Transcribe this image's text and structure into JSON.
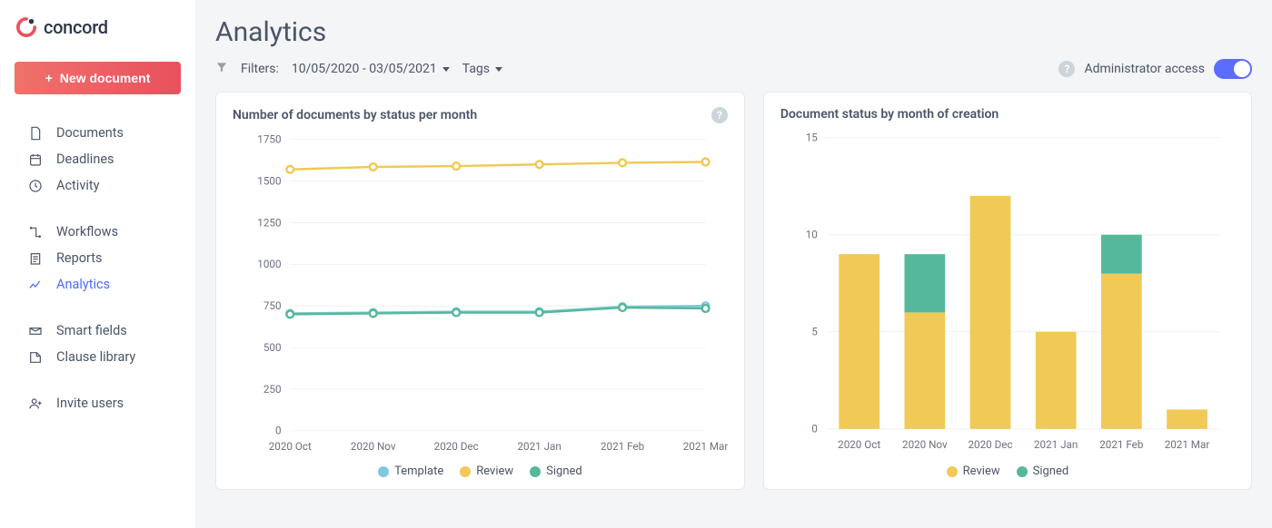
{
  "brand": {
    "name": "concord"
  },
  "sidebar": {
    "newDocument": "New document",
    "groups": [
      {
        "items": [
          {
            "label": "Documents",
            "icon": "document"
          },
          {
            "label": "Deadlines",
            "icon": "calendar"
          },
          {
            "label": "Activity",
            "icon": "clock"
          }
        ]
      },
      {
        "items": [
          {
            "label": "Workflows",
            "icon": "workflow"
          },
          {
            "label": "Reports",
            "icon": "report"
          },
          {
            "label": "Analytics",
            "icon": "analytics",
            "active": true
          }
        ]
      },
      {
        "items": [
          {
            "label": "Smart fields",
            "icon": "smartfields"
          },
          {
            "label": "Clause library",
            "icon": "clause"
          }
        ]
      },
      {
        "items": [
          {
            "label": "Invite users",
            "icon": "invite"
          }
        ]
      }
    ]
  },
  "header": {
    "title": "Analytics",
    "filtersLabel": "Filters:",
    "dateRange": "10/05/2020 - 03/05/2021",
    "tagsLabel": "Tags",
    "adminAccess": "Administrator access"
  },
  "cards": {
    "line": {
      "title": "Number of documents by status per month",
      "legend": {
        "template": "Template",
        "review": "Review",
        "signed": "Signed"
      }
    },
    "bar": {
      "title": "Document status by month of creation",
      "legend": {
        "review": "Review",
        "signed": "Signed"
      }
    }
  },
  "chart_data": [
    {
      "type": "line",
      "title": "Number of documents by status per month",
      "xlabel": "",
      "ylabel": "",
      "categories": [
        "2020 Oct",
        "2020 Nov",
        "2020 Dec",
        "2021 Jan",
        "2021 Feb",
        "2021 Mar"
      ],
      "ylim": [
        0,
        1750
      ],
      "yticks": [
        0,
        250,
        500,
        750,
        1000,
        1250,
        1500,
        1750
      ],
      "series": [
        {
          "name": "Template",
          "color": "#7fc7de",
          "values": [
            705,
            710,
            715,
            715,
            745,
            750
          ]
        },
        {
          "name": "Review",
          "color": "#f0c956",
          "values": [
            1570,
            1585,
            1590,
            1600,
            1610,
            1615
          ]
        },
        {
          "name": "Signed",
          "color": "#56b89a",
          "values": [
            700,
            705,
            710,
            710,
            740,
            735
          ]
        }
      ]
    },
    {
      "type": "bar-stacked",
      "title": "Document status by month of creation",
      "xlabel": "",
      "ylabel": "",
      "categories": [
        "2020 Oct",
        "2020 Nov",
        "2020 Dec",
        "2021 Jan",
        "2021 Feb",
        "2021 Mar"
      ],
      "ylim": [
        0,
        15
      ],
      "yticks": [
        0,
        5,
        10,
        15
      ],
      "series": [
        {
          "name": "Review",
          "color": "#f0c956",
          "values": [
            9,
            6,
            12,
            5,
            8,
            1
          ]
        },
        {
          "name": "Signed",
          "color": "#56b89a",
          "values": [
            0,
            3,
            0,
            0,
            2,
            0
          ]
        }
      ]
    }
  ],
  "colors": {
    "template": "#7fc7de",
    "review": "#f0c956",
    "signed": "#56b89a",
    "accent": "#5b6cff"
  }
}
